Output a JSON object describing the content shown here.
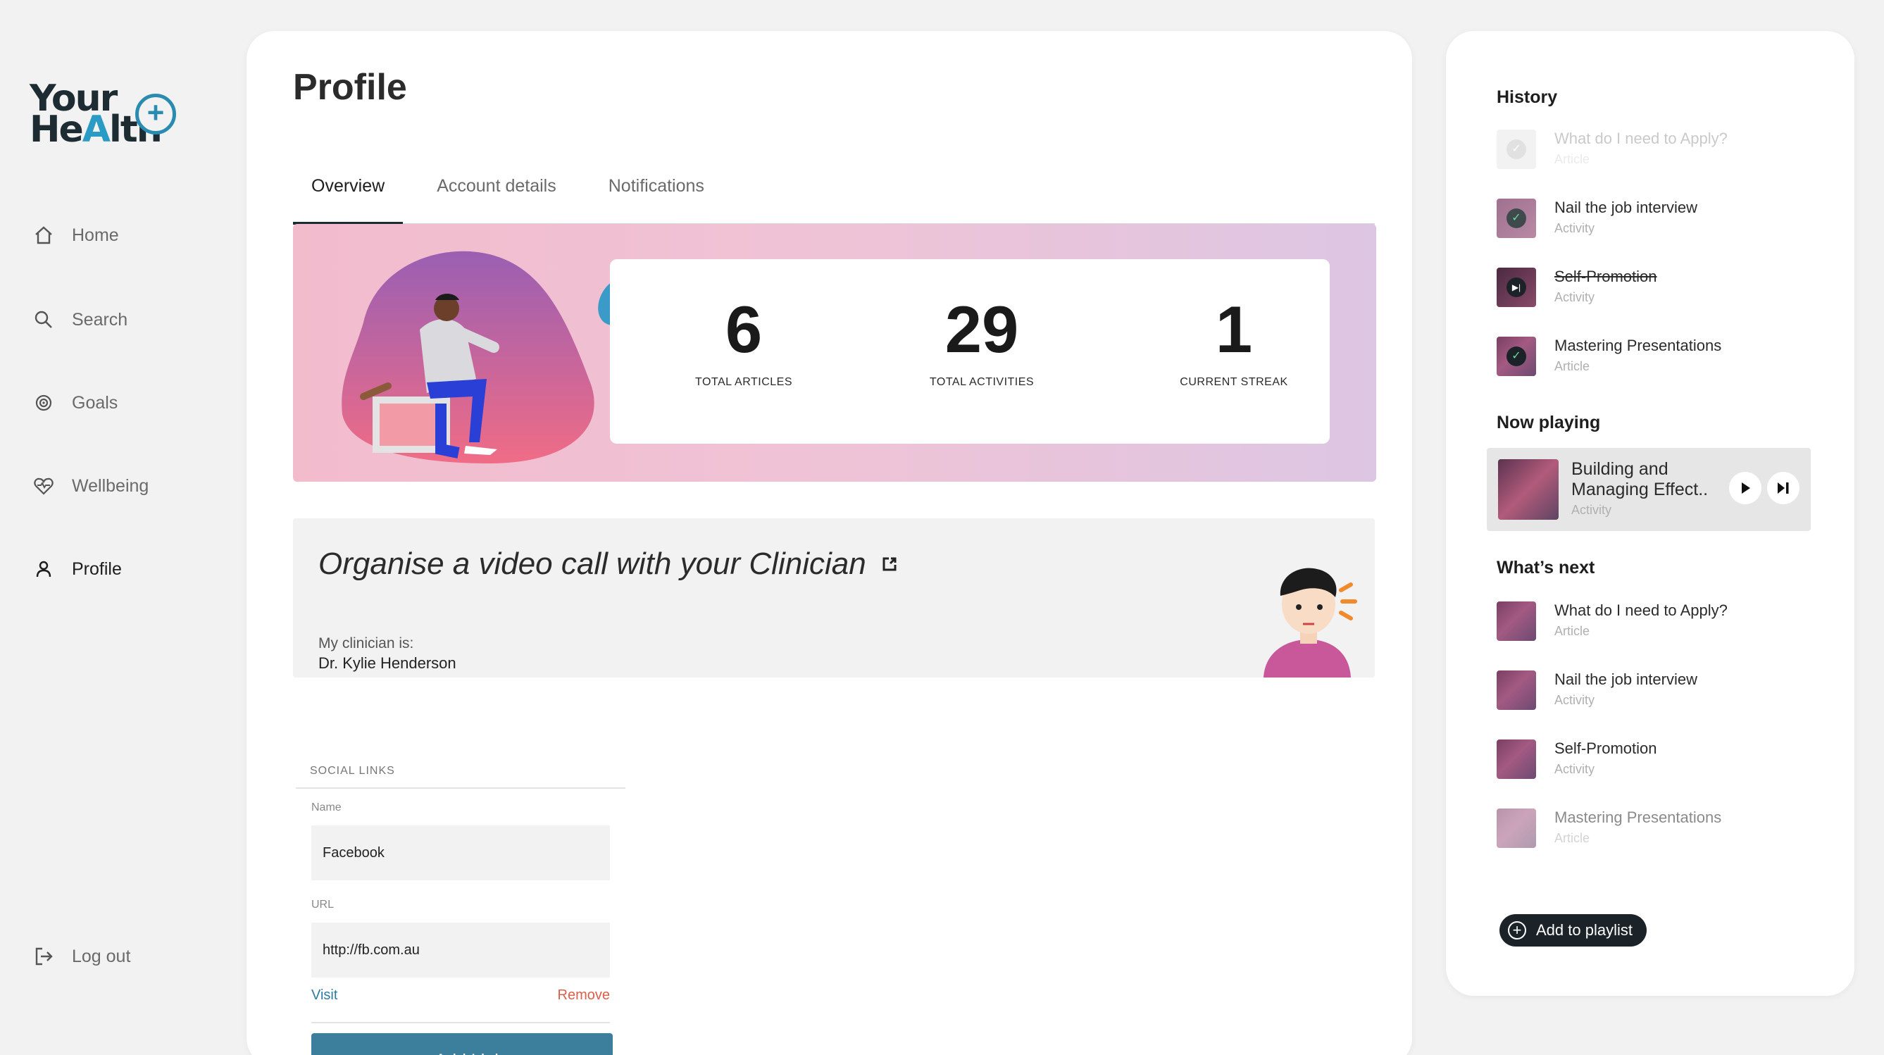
{
  "brand": {
    "line1": "Your",
    "line2_a": "He",
    "line2_b": "A",
    "line2_c": "lth",
    "plus": "+"
  },
  "nav": {
    "home": "Home",
    "search": "Search",
    "goals": "Goals",
    "wellbeing": "Wellbeing",
    "profile": "Profile",
    "logout": "Log out"
  },
  "main": {
    "title": "Profile",
    "tabs": [
      "Overview",
      "Account details",
      "Notifications"
    ],
    "active_tab": "Overview",
    "stats": [
      {
        "value": "6",
        "label": "TOTAL ARTICLES"
      },
      {
        "value": "29",
        "label": "TOTAL ACTIVITIES"
      },
      {
        "value": "1",
        "label": "CURRENT STREAK"
      }
    ],
    "call": {
      "title": "Organise a video call with your Clinician",
      "subtitle": "My clinician is:",
      "clinician": "Dr. Kylie Henderson"
    },
    "social": {
      "heading": "SOCIAL LINKS",
      "name_label": "Name",
      "name_value": "Facebook",
      "url_label": "URL",
      "url_value": "http://fb.com.au",
      "visit": "Visit",
      "remove": "Remove",
      "add_link": "+ Add Link"
    }
  },
  "right": {
    "history_title": "History",
    "history": [
      {
        "title": "What do I need to Apply?",
        "type": "Article"
      },
      {
        "title": "Nail the job interview",
        "type": "Activity"
      },
      {
        "title": "Self-Promotion",
        "type": "Activity"
      },
      {
        "title": "Mastering Presentations",
        "type": "Article"
      }
    ],
    "now_playing_title": "Now playing",
    "now_playing": {
      "title": "Building and Managing Effect..",
      "type": "Activity"
    },
    "next_title": "What’s next",
    "next": [
      {
        "title": "What do I need to Apply?",
        "type": "Article"
      },
      {
        "title": "Nail the job interview",
        "type": "Activity"
      },
      {
        "title": "Self-Promotion",
        "type": "Activity"
      },
      {
        "title": "Mastering Presentations",
        "type": "Article"
      }
    ],
    "playlist_button": "Add to playlist"
  },
  "colors": {
    "accent": "#3b7f9c",
    "dark": "#1b2328",
    "remove": "#d9604a",
    "visit": "#2e7ba0"
  }
}
